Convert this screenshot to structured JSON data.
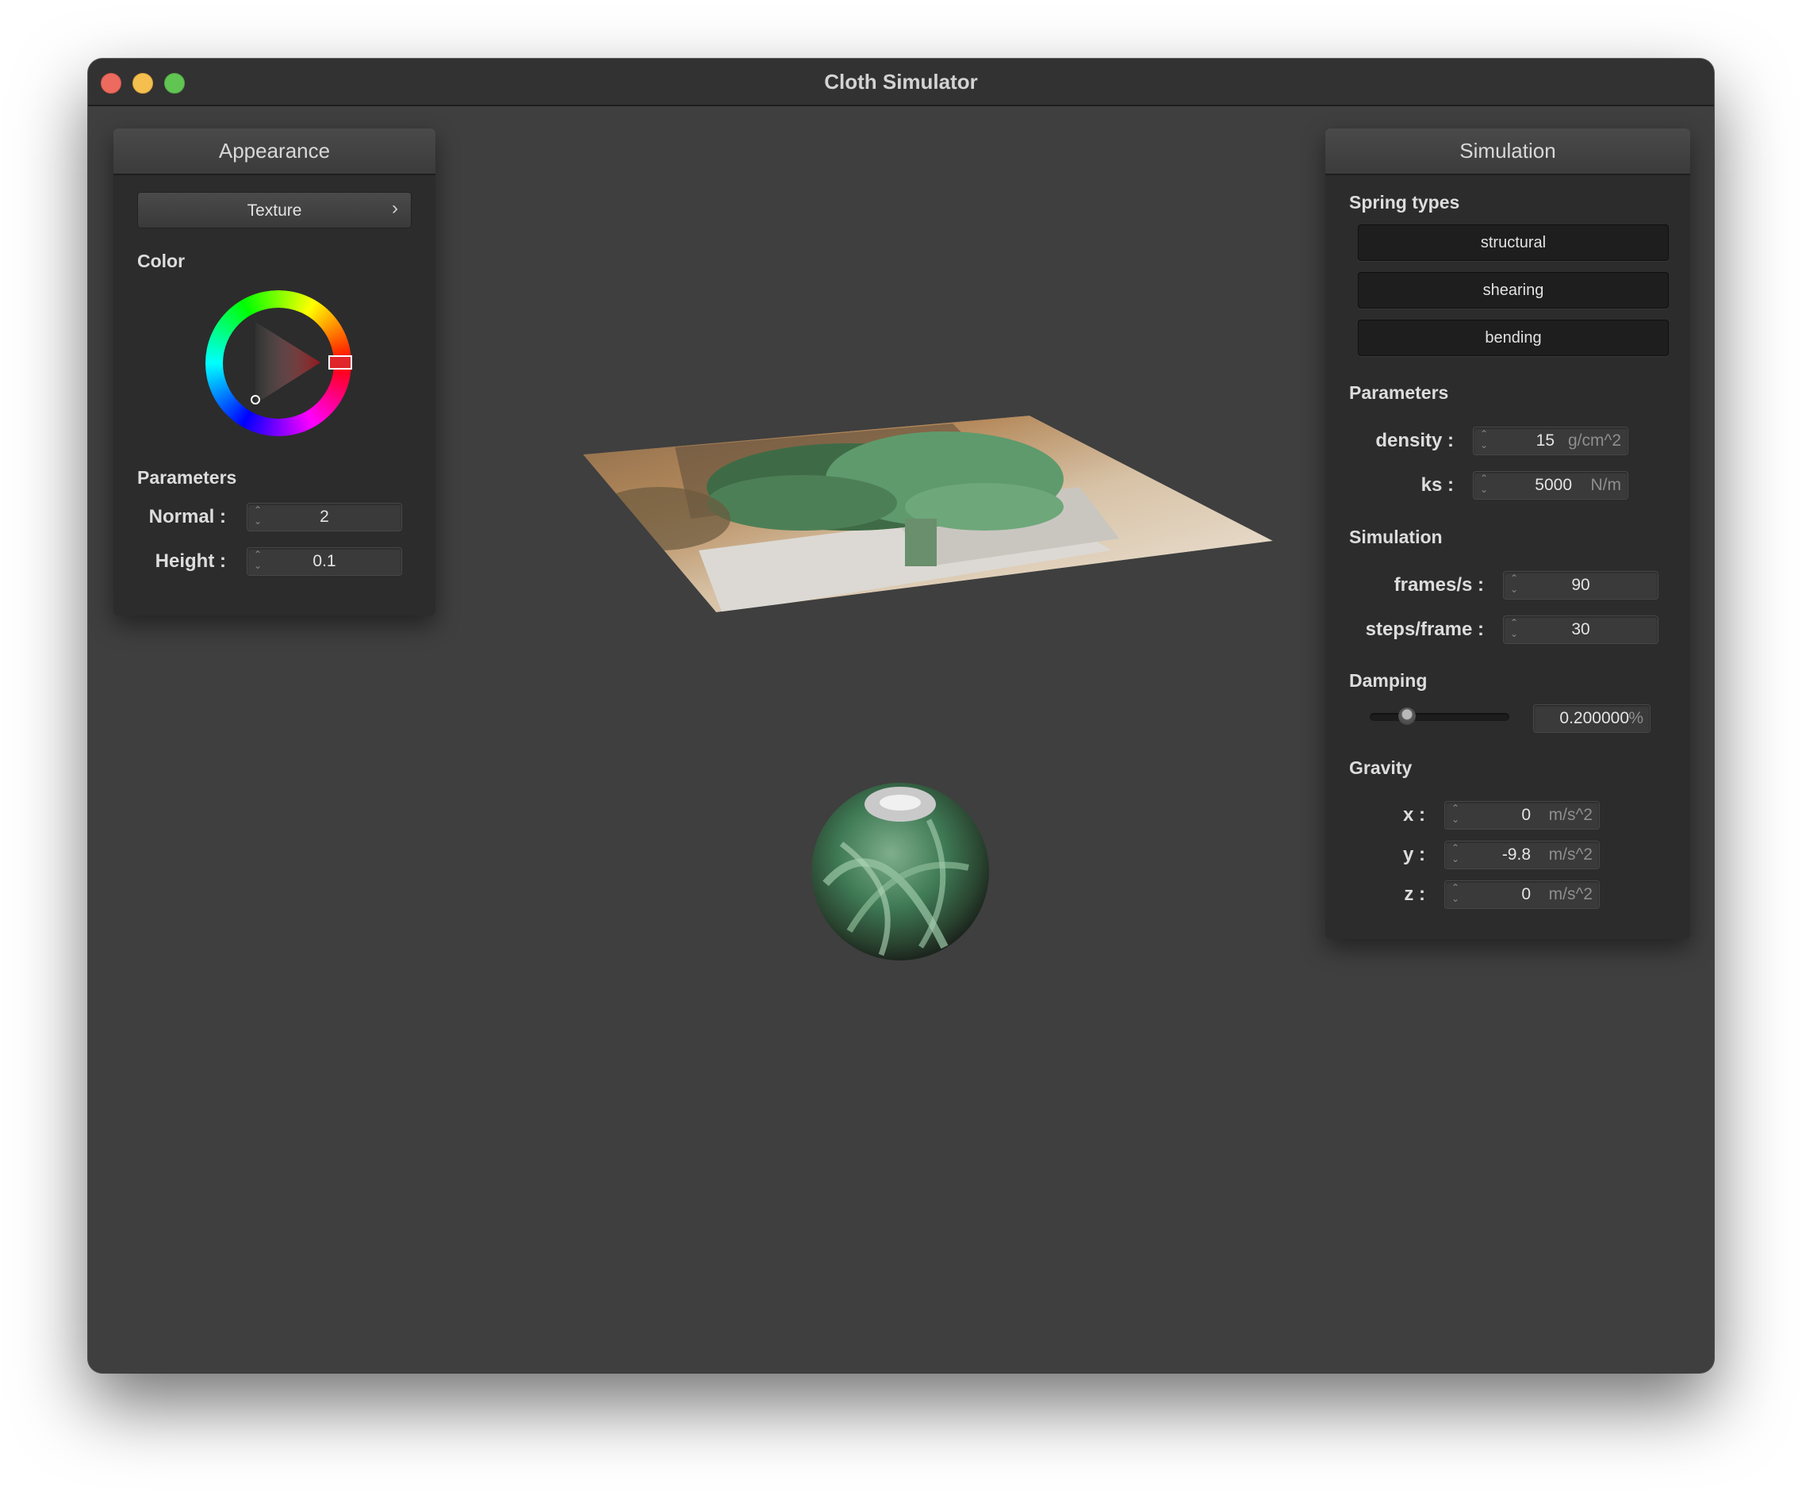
{
  "window": {
    "title": "Cloth Simulator"
  },
  "colors": {
    "close": "#ed6a5e",
    "minimize": "#f5bf4f",
    "zoom": "#61c554",
    "background": "#3f3f3f",
    "panel": "#2c2c2c"
  },
  "appearance": {
    "header": "Appearance",
    "texture_button": "Texture",
    "texture_chevron": "›",
    "color_label": "Color",
    "selected_color": "#e0252b",
    "parameters_label": "Parameters",
    "normal_label": "Normal :",
    "normal_value": "2",
    "height_label": "Height :",
    "height_value": "0.1"
  },
  "simulation": {
    "header": "Simulation",
    "spring_types_label": "Spring types",
    "spring_buttons": [
      "structural",
      "shearing",
      "bending"
    ],
    "parameters_label": "Parameters",
    "density_label": "density :",
    "density_value": "15",
    "density_unit": "g/cm^2",
    "ks_label": "ks :",
    "ks_value": "5000",
    "ks_unit": "N/m",
    "simulation_label": "Simulation",
    "fps_label": "frames/s :",
    "fps_value": "90",
    "steps_label": "steps/frame :",
    "steps_value": "30",
    "damping_label": "Damping",
    "damping_value": "0.200000",
    "damping_unit": "%",
    "damping_fraction": 0.2,
    "gravity_label": "Gravity",
    "x_label": "x :",
    "x_value": "0",
    "y_label": "y :",
    "y_value": "-9.8",
    "z_label": "z :",
    "z_value": "0",
    "gravity_unit": "m/s^2"
  }
}
